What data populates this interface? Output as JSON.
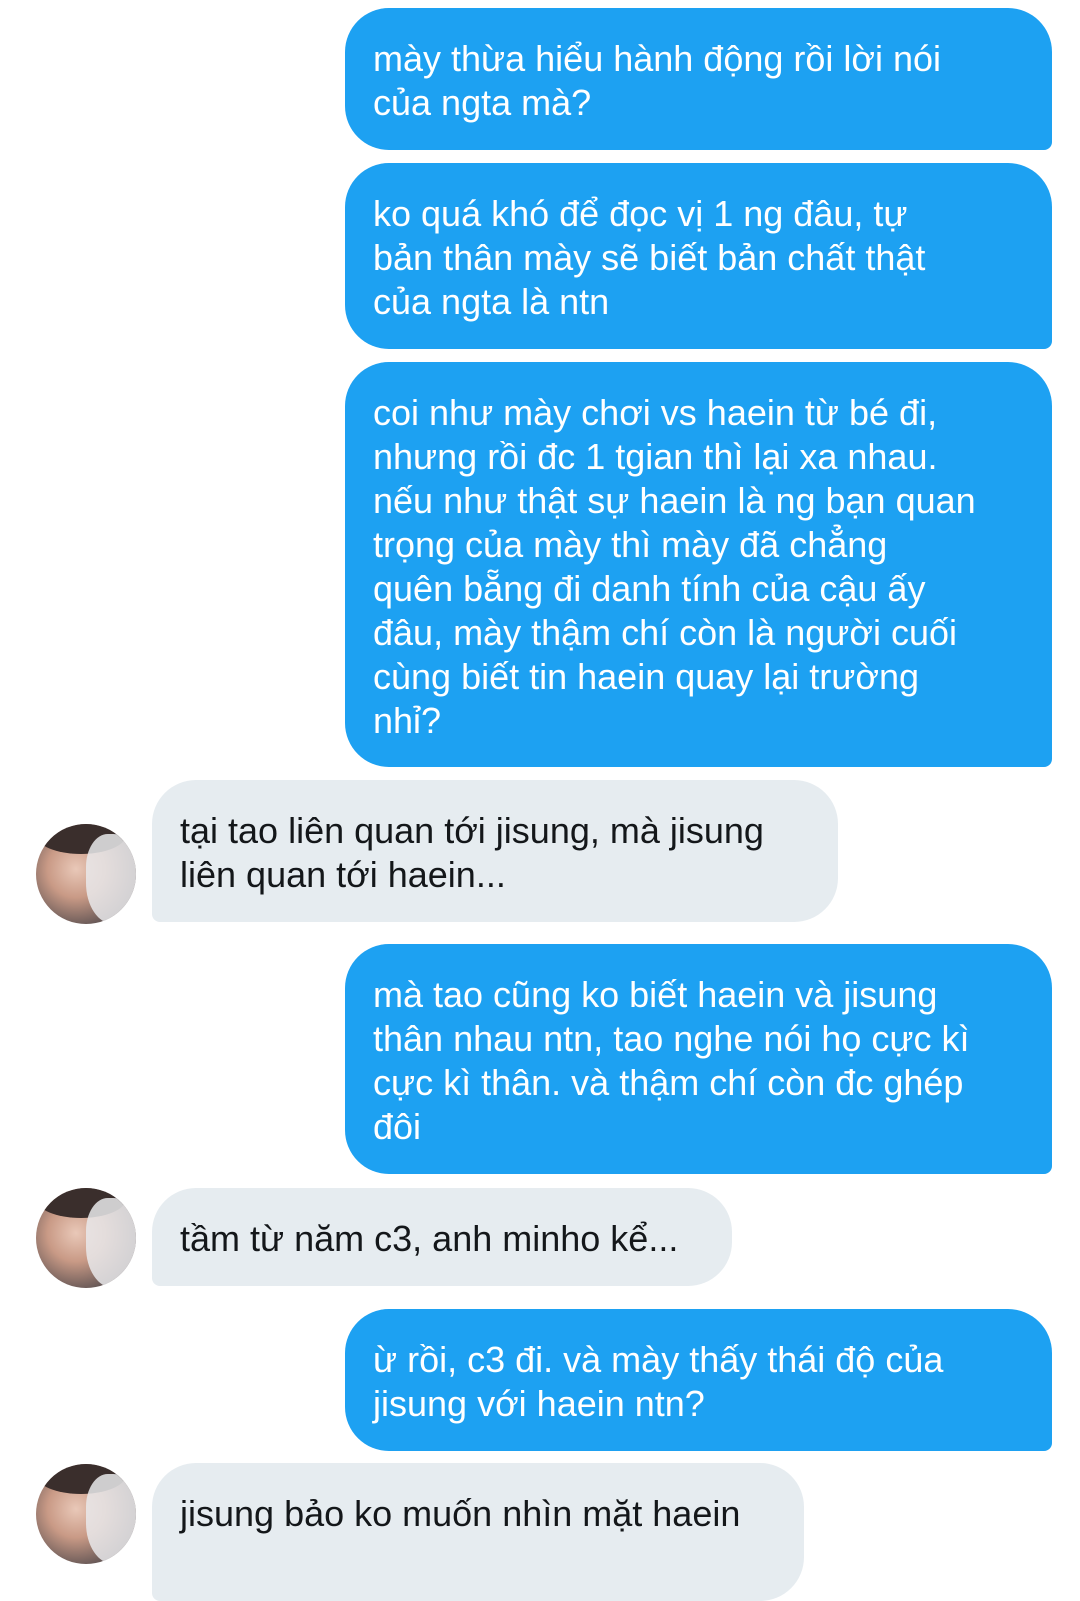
{
  "messages": [
    {
      "sender": "me",
      "text": "mày thừa hiểu hành động rồi lời nói\ncủa ngta mà?"
    },
    {
      "sender": "me",
      "text": "ko quá khó để đọc vị 1 ng đâu, tự\nbản thân mày sẽ biết bản chất thật\ncủa ngta là ntn"
    },
    {
      "sender": "me",
      "text": "coi như mày chơi vs haein từ bé đi,\nnhưng rồi đc 1 tgian thì lại xa nhau.\nnếu như thật sự haein là ng bạn quan\ntrọng của mày thì mày đã chẳng\nquên bẵng đi danh tính của cậu ấy\nđâu, mày thậm chí còn là người cuối\ncùng biết tin haein quay lại trường\nnhỉ?"
    },
    {
      "sender": "them",
      "text": "tại tao liên quan tới jisung, mà jisung\nliên quan tới haein..."
    },
    {
      "sender": "me",
      "text": "mà tao cũng ko biết haein và jisung\nthân nhau ntn, tao nghe nói họ cực kì\ncực kì thân. và thậm chí còn đc ghép\nđôi"
    },
    {
      "sender": "them",
      "text": "tầm từ năm c3, anh minho kể..."
    },
    {
      "sender": "me",
      "text": "ừ rồi, c3 đi. và mày thấy thái độ của\njisung với haein ntn?"
    },
    {
      "sender": "them",
      "text": "jisung bảo ko muốn nhìn mặt haein"
    }
  ],
  "colors": {
    "sent_bubble": "#1da1f2",
    "received_bubble": "#e6ecf0",
    "sent_text": "#ffffff",
    "received_text": "#14171a"
  }
}
